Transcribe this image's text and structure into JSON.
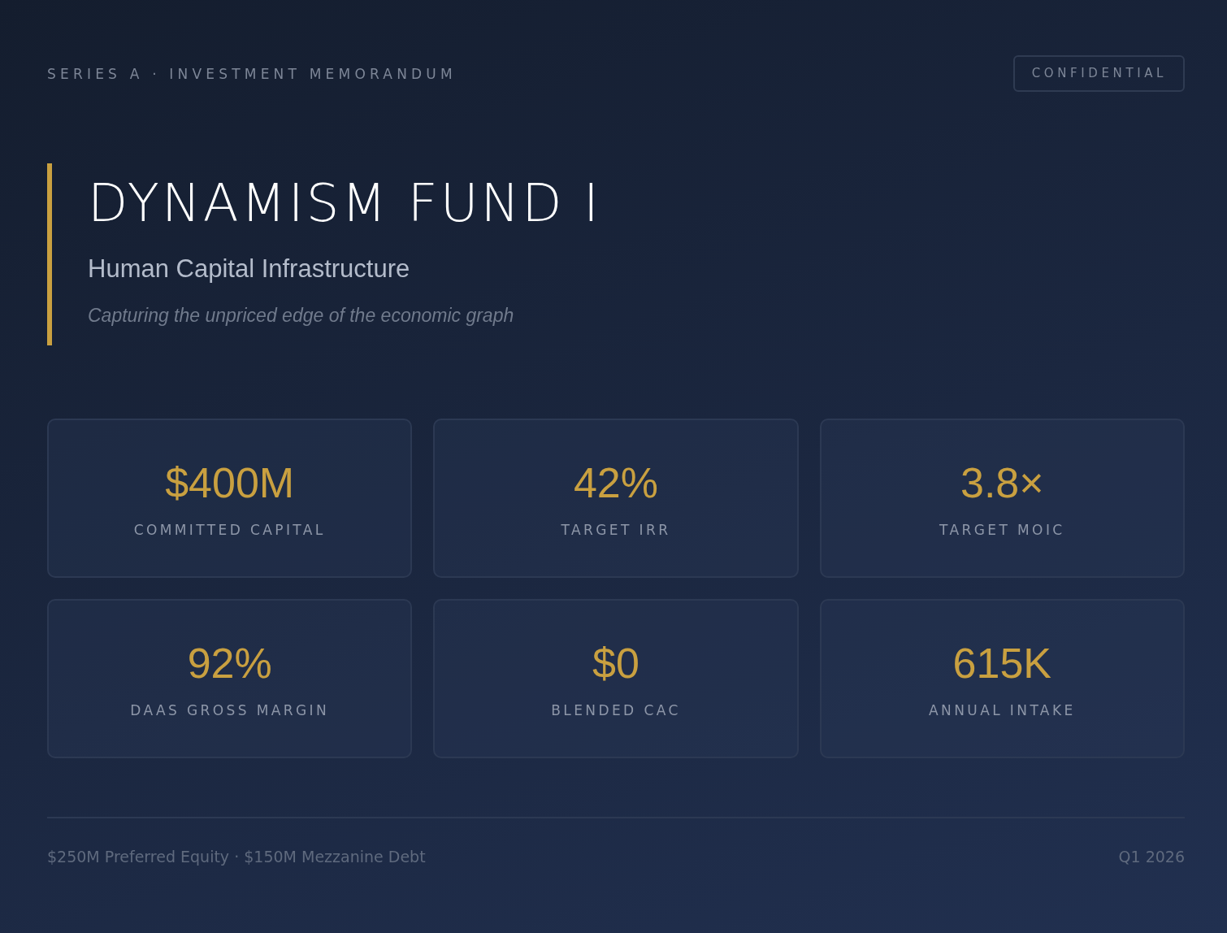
{
  "header": {
    "eyebrow": "SERIES A · INVESTMENT MEMORANDUM",
    "badge": "CONFIDENTIAL"
  },
  "hero": {
    "title": "DYNAMISM FUND I",
    "subtitle": "Human Capital Infrastructure",
    "tagline": "Capturing the unpriced edge of the economic graph"
  },
  "metrics": [
    {
      "value": "$400M",
      "label": "COMMITTED CAPITAL"
    },
    {
      "value": "42%",
      "label": "TARGET IRR"
    },
    {
      "value": "3.8×",
      "label": "TARGET MOIC"
    },
    {
      "value": "92%",
      "label": "DAAS GROSS MARGIN"
    },
    {
      "value": "$0",
      "label": "BLENDED CAC"
    },
    {
      "value": "615K",
      "label": "ANNUAL INTAKE"
    }
  ],
  "footer": {
    "structure": "$250M Preferred Equity · $150M Mezzanine Debt",
    "date": "Q1 2026"
  }
}
